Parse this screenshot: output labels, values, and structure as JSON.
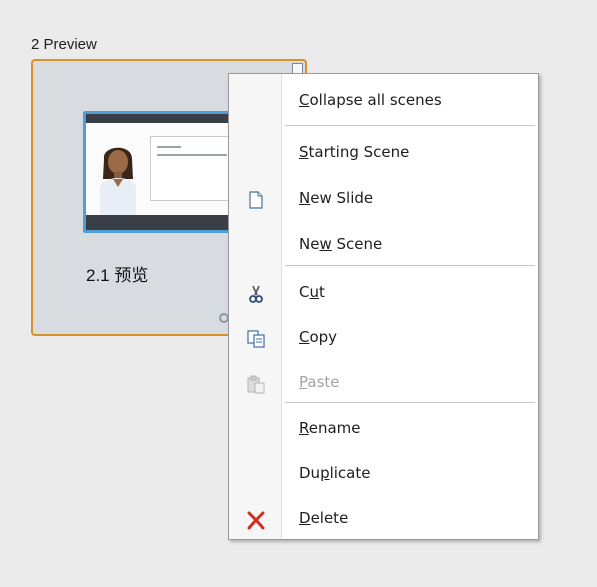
{
  "scene": {
    "title": "2 Preview",
    "slide_label": "2.1 预览"
  },
  "context_menu": {
    "items": [
      {
        "pre": "",
        "ul": "C",
        "post": "ollapse all scenes",
        "enabled": true,
        "icon": ""
      },
      {
        "pre": "",
        "ul": "S",
        "post": "tarting Scene",
        "enabled": true,
        "icon": ""
      },
      {
        "pre": "",
        "ul": "N",
        "post": "ew Slide",
        "enabled": true,
        "icon": "new-slide-icon"
      },
      {
        "pre": "Ne",
        "ul": "w",
        "post": " Scene",
        "enabled": true,
        "icon": ""
      },
      {
        "pre": "C",
        "ul": "u",
        "post": "t",
        "enabled": true,
        "icon": "scissors-icon"
      },
      {
        "pre": "",
        "ul": "C",
        "post": "opy",
        "enabled": true,
        "icon": "copy-icon"
      },
      {
        "pre": "",
        "ul": "P",
        "post": "aste",
        "enabled": false,
        "icon": "paste-icon"
      },
      {
        "pre": "",
        "ul": "R",
        "post": "ename",
        "enabled": true,
        "icon": ""
      },
      {
        "pre": "Du",
        "ul": "p",
        "post": "licate",
        "enabled": true,
        "icon": ""
      },
      {
        "pre": "",
        "ul": "D",
        "post": "elete",
        "enabled": true,
        "icon": "delete-x-icon"
      }
    ]
  },
  "colors": {
    "selection_border": "#d8922a",
    "thumbnail_border": "#4f9fd6",
    "delete_icon": "#d12f1e",
    "disabled_text": "#a3a3a3"
  }
}
